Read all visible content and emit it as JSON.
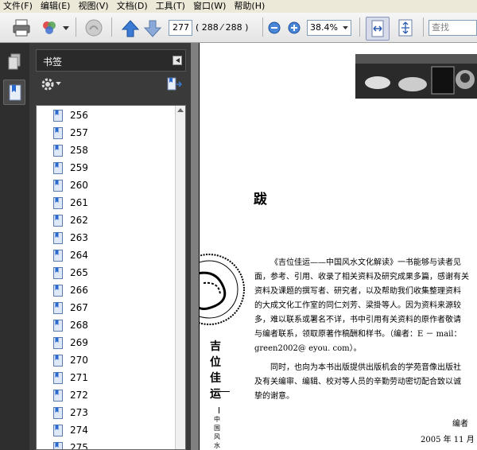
{
  "menu": [
    "文件(F)",
    "编辑(E)",
    "视图(V)",
    "文档(D)",
    "工具(T)",
    "窗口(W)",
    "帮助(H)"
  ],
  "toolbar": {
    "page_input": "277",
    "page_count": "( 288 ⁄ 288 )",
    "zoom_value": "38.4%",
    "search_placeholder": "查找"
  },
  "panel": {
    "title": "书签",
    "bookmarks": [
      "256",
      "257",
      "258",
      "259",
      "260",
      "261",
      "262",
      "263",
      "264",
      "265",
      "266",
      "267",
      "268",
      "269",
      "270",
      "271",
      "272",
      "273",
      "274",
      "275"
    ]
  },
  "document": {
    "heading": "跋",
    "paragraph1": [
      "《吉位佳运——中国风水文化解读》一书能够与读者见",
      "面，参考、引用、收录了相关资料及研究成果多篇，感谢有关",
      "资料及课题的撰写者、研究者，以及帮助我们收集整理资料",
      "的大成文化工作室的同仁刘芳、梁掛等人。因为资料来源较",
      "多，难以联系或署名不详，书中引用有关资料的原作者敬请",
      "与编者联系，领取原著作稿酬和样书。（编者：E － mail：",
      "green2002@ eyou. com）。"
    ],
    "paragraph2": [
      "同时，也向为本书出版提供出版机会的学苑音像出版社",
      "及有关编审、编辑、校对等人员的辛勤劳动密切配合致以诚",
      "挚的谢意。"
    ],
    "author": "编者",
    "date": "2005 年 11 月",
    "side_title": "吉位佳运",
    "side_subtitle": "中国风水文化"
  },
  "colors": {
    "panel_bg": "#3a3a3a",
    "nav_bg": "#2e2e2e",
    "doc_bg": "#808080",
    "accent_blue": "#3a7bd5"
  }
}
